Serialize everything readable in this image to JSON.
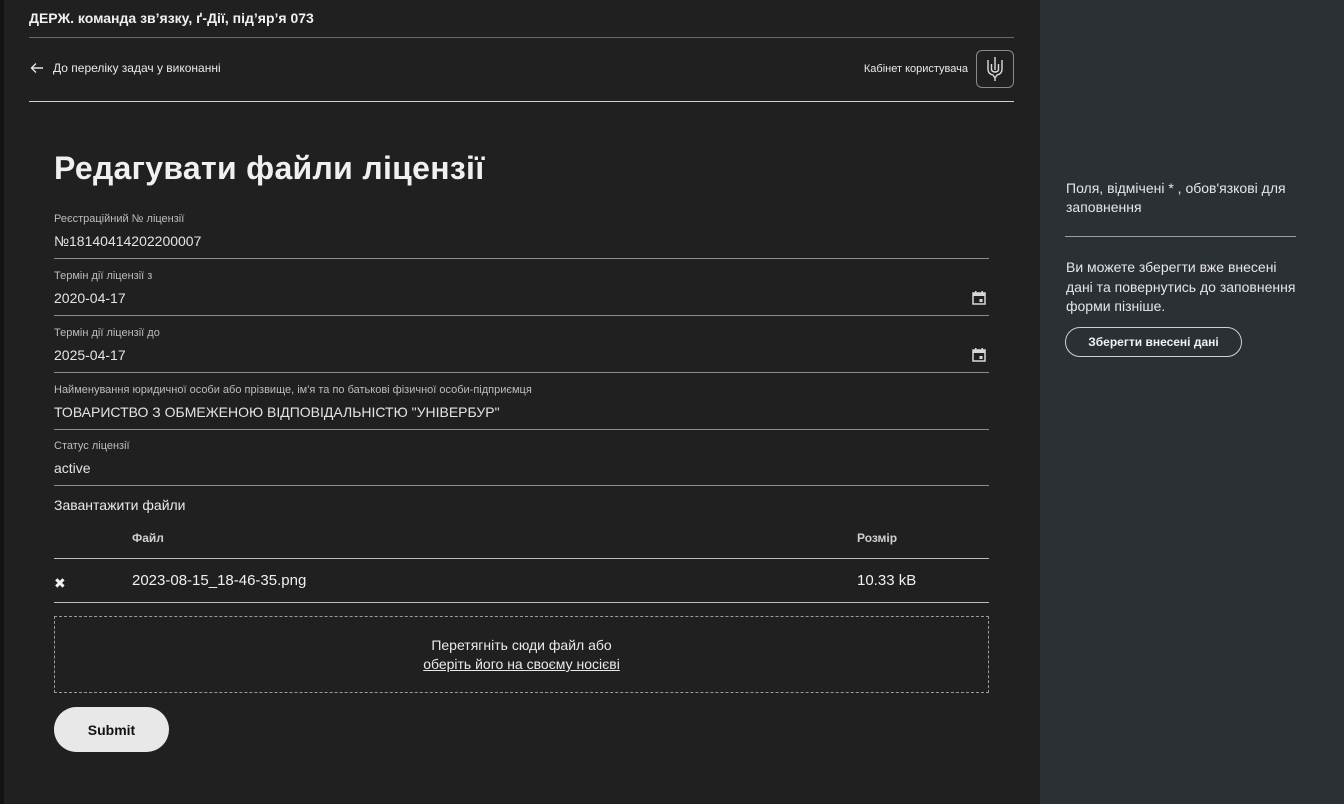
{
  "header": {
    "org": "ДЕРЖ. команда зв’язку, ґ-Дії, під’яр’я 073",
    "back_link": "До переліку задач у виконанні",
    "cabinet": "Кабінет користувача"
  },
  "form": {
    "title": "Редагувати файли ліцензії",
    "fields": [
      {
        "label": "Реєстраційний № ліцензії",
        "value": "№18140414202200007"
      },
      {
        "label": "Термін дії ліцензії з",
        "value": "2020-04-17"
      },
      {
        "label": "Термін дії ліцензії до",
        "value": "2025-04-17"
      },
      {
        "label": "Найменування юридичної особи або прізвище, ім'я та по батькові фізичної особи-підприємця",
        "value": "ТОВАРИСТВО З ОБМЕЖЕНОЮ ВІДПОВІДАЛЬНІСТЮ \"УНІВЕРБУР\""
      },
      {
        "label": "Статус ліцензії",
        "value": "active"
      }
    ],
    "upload": {
      "title": "Завантажити файли",
      "col_file": "Файл",
      "col_size": "Розмір",
      "files": [
        {
          "remove_glyph": "✖",
          "name": "2023-08-15_18-46-35.png",
          "size": "10.33 kB"
        }
      ],
      "drop_text": "Перетягніть сюди файл або",
      "drop_link": "оберіть його на своєму носієві"
    },
    "submit": "Submit"
  },
  "sidebar": {
    "required_note": "Поля, відмічені * , обов'язкові для заповнення",
    "save_note": "Ви можете зберегти вже внесені дані та повернутись до заповнення форми пізніше.",
    "save_button": "Зберегти внесені дані"
  }
}
